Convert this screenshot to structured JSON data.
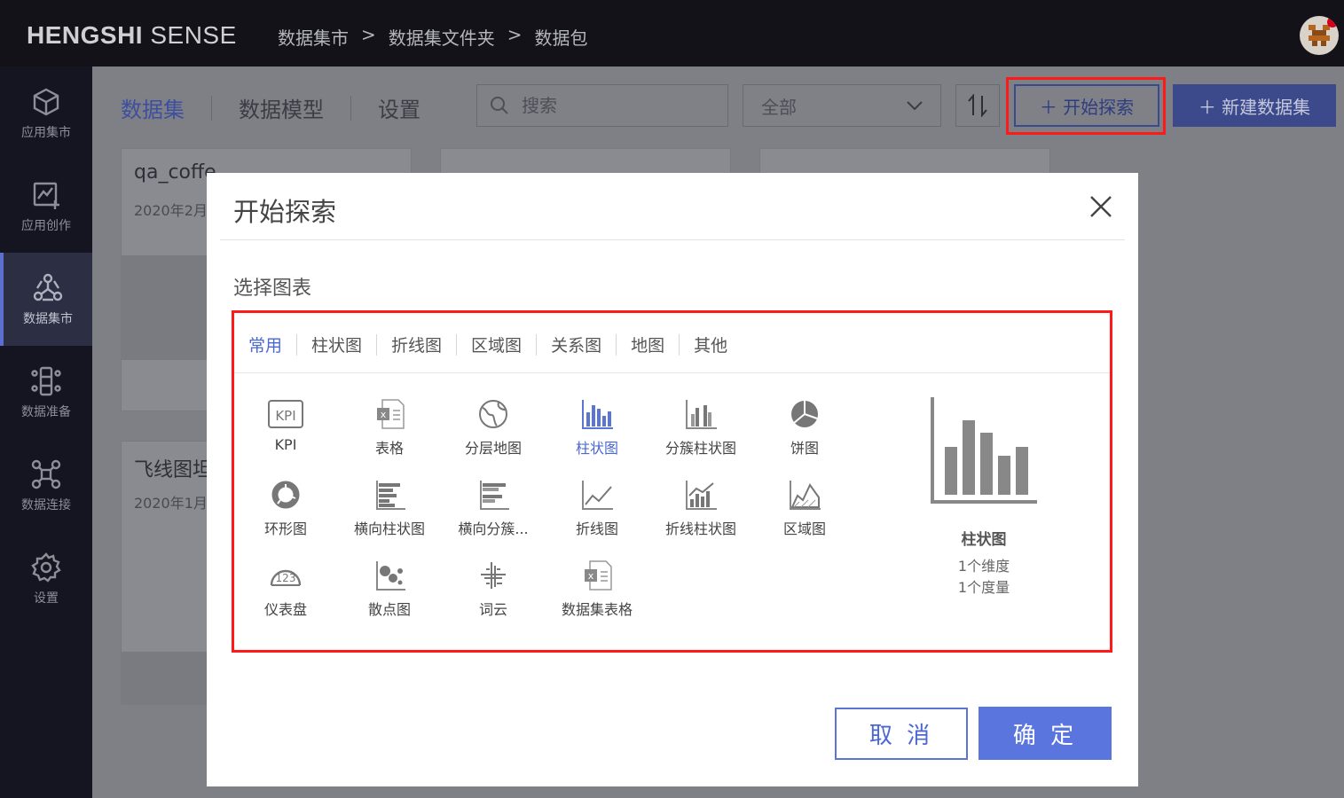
{
  "app": {
    "logo_bold": "HENGSHI",
    "logo_light": " SENSE"
  },
  "breadcrumb": [
    "数据集市",
    ">",
    "数据集文件夹",
    ">",
    "数据包"
  ],
  "sidebar": {
    "items": [
      {
        "label": "应用集市",
        "icon": "cube-icon"
      },
      {
        "label": "应用创作",
        "icon": "chart-add-icon"
      },
      {
        "label": "数据集市",
        "icon": "hexagon-network-icon",
        "active": true
      },
      {
        "label": "数据准备",
        "icon": "data-prep-icon"
      },
      {
        "label": "数据连接",
        "icon": "connection-icon"
      },
      {
        "label": "设置",
        "icon": "gear-icon"
      }
    ]
  },
  "main": {
    "tabs": [
      {
        "label": "数据集",
        "active": true
      },
      {
        "label": "数据模型"
      },
      {
        "label": "设置"
      }
    ],
    "search_placeholder": "搜索",
    "filter_value": "全部",
    "explore_button": "＋ 开始探索",
    "new_dataset_button": "＋ 新建数据集",
    "cards": [
      {
        "title": "qa_coffe",
        "date": "2020年2月"
      },
      {
        "title": "",
        "date": ""
      },
      {
        "title": "",
        "date": ""
      },
      {
        "title": "飞线图坦",
        "date": "2020年1月"
      }
    ]
  },
  "modal": {
    "title": "开始探索",
    "section_label": "选择图表",
    "category_tabs": [
      {
        "label": "常用",
        "active": true
      },
      {
        "label": "柱状图"
      },
      {
        "label": "折线图"
      },
      {
        "label": "区域图"
      },
      {
        "label": "关系图"
      },
      {
        "label": "地图"
      },
      {
        "label": "其他"
      }
    ],
    "chart_types": [
      {
        "label": "KPI",
        "icon": "kpi-icon"
      },
      {
        "label": "表格",
        "icon": "table-excel-icon"
      },
      {
        "label": "分层地图",
        "icon": "globe-icon"
      },
      {
        "label": "柱状图",
        "icon": "bar-chart-icon",
        "selected": true
      },
      {
        "label": "分簇柱状图",
        "icon": "grouped-bar-icon"
      },
      {
        "label": "饼图",
        "icon": "pie-chart-icon"
      },
      {
        "label": "环形图",
        "icon": "donut-chart-icon"
      },
      {
        "label": "横向柱状图",
        "icon": "horizontal-bar-icon"
      },
      {
        "label": "横向分簇...",
        "icon": "horizontal-grouped-bar-icon"
      },
      {
        "label": "折线图",
        "icon": "line-chart-icon"
      },
      {
        "label": "折线柱状图",
        "icon": "line-bar-combo-icon"
      },
      {
        "label": "区域图",
        "icon": "area-chart-icon"
      },
      {
        "label": "仪表盘",
        "icon": "gauge-icon"
      },
      {
        "label": "散点图",
        "icon": "scatter-icon"
      },
      {
        "label": "词云",
        "icon": "word-cloud-icon"
      },
      {
        "label": "数据集表格",
        "icon": "dataset-table-icon"
      }
    ],
    "preview": {
      "name": "柱状图",
      "dimensions": "1个维度",
      "measures": "1个度量"
    },
    "cancel_button": "取 消",
    "ok_button": "确 定"
  },
  "colors": {
    "accent": "#5a75de",
    "highlight": "#ff1a1a",
    "topbar": "#121218",
    "sidebar": "#141520"
  }
}
